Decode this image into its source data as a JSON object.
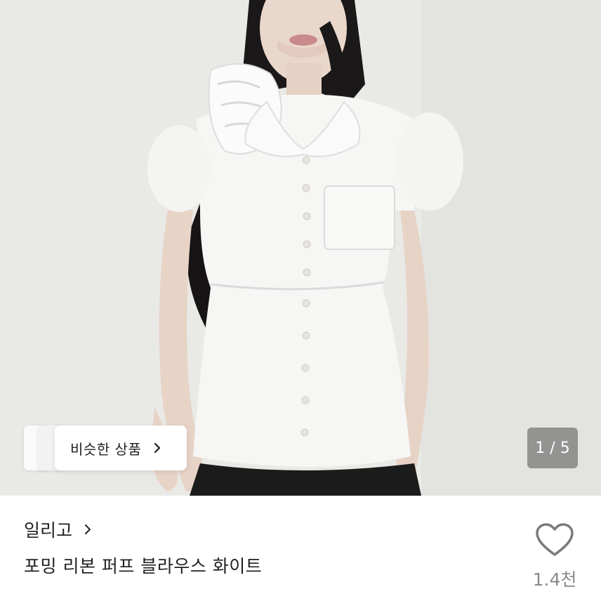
{
  "photo": {
    "current_index": "1",
    "total": "5",
    "counter_text": "1 / 5",
    "alt": ""
  },
  "similar": {
    "label": "비슷한 상품"
  },
  "store": {
    "name": "일리고"
  },
  "product": {
    "title": "포밍 리본 퍼프 블라우스 화이트"
  },
  "likes": {
    "count": "1.4천"
  },
  "icons": {
    "heart": "heart-icon",
    "chevron": "chevron-right-icon"
  },
  "colors": {
    "text": "#222222",
    "muted": "#8a8a8a",
    "counter_bg": "#787878"
  }
}
